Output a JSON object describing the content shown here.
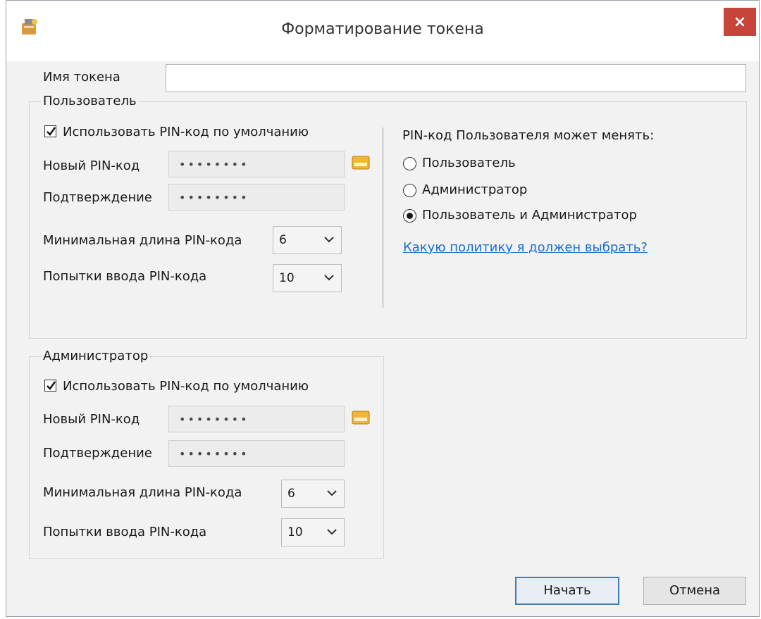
{
  "window": {
    "title": "Форматирование токена",
    "close_label": "×"
  },
  "token": {
    "name_label": "Имя токена",
    "name_value": ""
  },
  "user_group": {
    "title": "Пользователь",
    "use_default_label": "Использовать PIN-код по умолчанию",
    "use_default_checked": true,
    "new_pin_label": "Новый PIN-код",
    "new_pin_value": "••••••••",
    "confirm_label": "Подтверждение",
    "confirm_value": "••••••••",
    "min_length_label": "Минимальная длина PIN-кода",
    "min_length_value": "6",
    "attempts_label": "Попытки ввода PIN-кода",
    "attempts_value": "10"
  },
  "pin_policy": {
    "heading": "PIN-код Пользователя может менять:",
    "options": [
      {
        "label": "Пользователь",
        "selected": false
      },
      {
        "label": "Администратор",
        "selected": false
      },
      {
        "label": "Пользователь и Администратор",
        "selected": true
      }
    ],
    "help_link": "Какую политику я должен выбрать?"
  },
  "admin_group": {
    "title": "Администратор",
    "use_default_label": "Использовать PIN-код по умолчанию",
    "use_default_checked": true,
    "new_pin_label": "Новый PIN-код",
    "new_pin_value": "••••••••",
    "confirm_label": "Подтверждение",
    "confirm_value": "••••••••",
    "min_length_label": "Минимальная длина PIN-кода",
    "min_length_value": "6",
    "attempts_label": "Попытки ввода PIN-кода",
    "attempts_value": "10"
  },
  "buttons": {
    "start_label": "Начать",
    "cancel_label": "Отмена"
  }
}
